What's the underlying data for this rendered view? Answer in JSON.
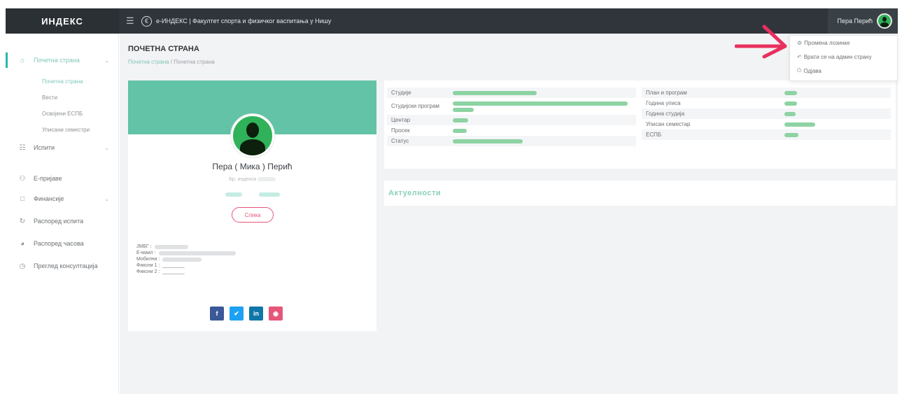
{
  "topbar": {
    "brand": "ИНДЕКС",
    "app_title": "e-ИНДЕКС | Факултет спорта и физичког васпитања у Нишу",
    "user_name": "Пера Перић"
  },
  "sidebar": {
    "items": [
      {
        "label": "Почетна страна",
        "icon": "home-icon",
        "active": true
      },
      {
        "label": "Испити",
        "icon": "list-icon"
      },
      {
        "label": "Е-пријаве",
        "icon": "users-icon"
      },
      {
        "label": "Финансије",
        "icon": "folder-icon"
      },
      {
        "label": "Распоред испита",
        "icon": "reload-icon"
      },
      {
        "label": "Распоред часова",
        "icon": "calendar-icon"
      },
      {
        "label": "Преглед консултација",
        "icon": "clock-icon"
      }
    ],
    "subitems": [
      "Почетна страна",
      "Вести",
      "Освојени ЕСПБ",
      "Уписани семестри"
    ]
  },
  "page": {
    "title": "ПОЧЕТНА СТРАНА",
    "breadcrumb_root": "Почетна страна",
    "breadcrumb_separator": "/",
    "breadcrumb_current": "Почетна страна"
  },
  "profile": {
    "name": "Пера ( Мика ) Перић",
    "index_label": "Бр. индекса",
    "edit_button": "Слика",
    "contact_labels": [
      "ЈМБГ :",
      "E-маил :",
      "Мобилни :",
      "Фиксни 1 :",
      "Фиксни 2 :"
    ],
    "fixed_placeholder": "________"
  },
  "info": {
    "left": [
      {
        "label": "Студије"
      },
      {
        "label": "Студијски програм"
      },
      {
        "label": "Центар"
      },
      {
        "label": "Просек"
      },
      {
        "label": "Статус"
      }
    ],
    "right": [
      {
        "label": "План и програм"
      },
      {
        "label": "Година уписа"
      },
      {
        "label": "Година студија"
      },
      {
        "label": "Уписан семестар"
      },
      {
        "label": "ЕСПБ"
      }
    ]
  },
  "updates": {
    "title": "Актуелности"
  },
  "dropdown": {
    "items": [
      {
        "label": "Промена лозинке",
        "icon": "key-icon"
      },
      {
        "label": "Врати се на админ страну",
        "icon": "return-icon"
      },
      {
        "label": "Одјава",
        "icon": "logout-icon"
      }
    ]
  },
  "colors": {
    "topbar": "#2f353b",
    "accent": "#63c3a6",
    "link": "#7fc7b7",
    "avatar": "#30b25a",
    "arrow": "#e8305f",
    "edit_button": "#e5567a"
  }
}
